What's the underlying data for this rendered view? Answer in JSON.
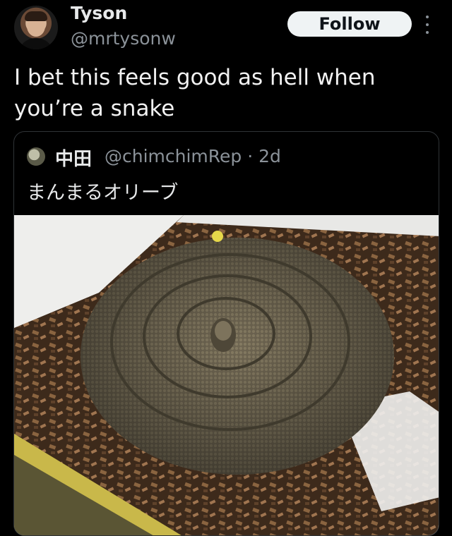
{
  "author": {
    "name": "Tyson",
    "handle": "@mrtysonw",
    "avatar_icon": "profile-avatar"
  },
  "follow_button": {
    "label": "Follow"
  },
  "more_icon": "more-vertical-icon",
  "tweet": {
    "text_line1": "I bet this feels good as hell when",
    "text_line2": "you’re a snake"
  },
  "quoted_tweet": {
    "author_name": "中田",
    "handle_and_time": "@chimchimRep · 2d",
    "text": "まんまるオリーブ",
    "image_subject": "coiled-olive-python-photo"
  },
  "colors": {
    "background": "#000000",
    "primary_text": "#e7e9ea",
    "secondary_text": "#8b9299",
    "follow_button_bg": "#eff3f4",
    "border": "#2f3336"
  }
}
